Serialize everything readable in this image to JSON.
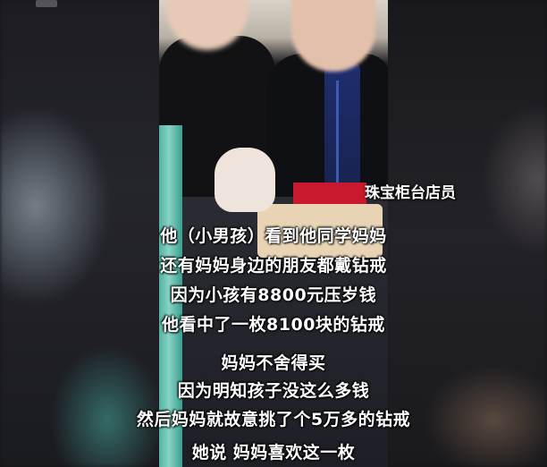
{
  "watermark": "",
  "caption_label": "珠宝柜台店员",
  "subtitles": [
    "他（小男孩）看到他同学妈妈",
    "还有妈妈身边的朋友都戴钻戒",
    "因为小孩有8800元压岁钱",
    "他看中了一枚8100块的钻戒",
    "妈妈不舍得买",
    "因为明知孩子没这么多钱",
    "然后妈妈就故意挑了个5万多的钻戒",
    "她说 妈妈喜欢这一枚"
  ]
}
